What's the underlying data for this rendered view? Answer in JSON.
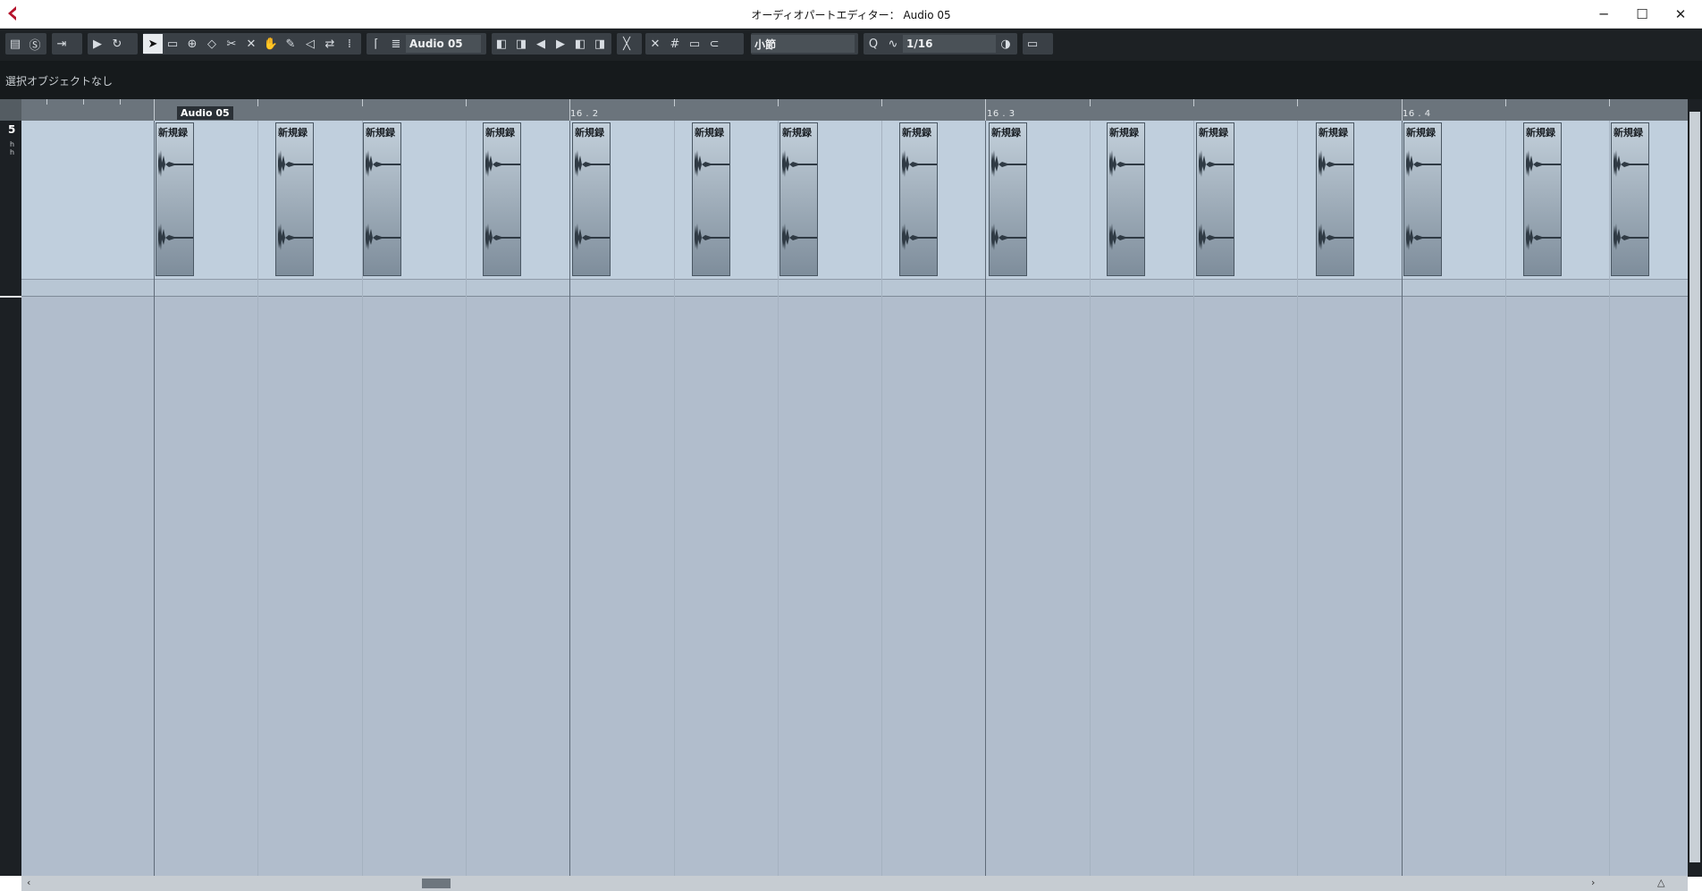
{
  "window": {
    "title": "オーディオパートエディター： Audio 05",
    "minimize": "─",
    "maximize": "☐",
    "close": "✕",
    "brand_color": "#b5122b"
  },
  "toolbar": {
    "part_name": "Audio 05",
    "grid_type": "小節",
    "quantize_label": "Q",
    "quantize_value": "1/16",
    "icons": [
      "inspector-icon",
      "solo-icon",
      "autoscroll-icon",
      "play-icon",
      "loop-icon",
      "object-select-icon",
      "range-icon",
      "zoom-icon",
      "draw-event-icon",
      "split-icon",
      "glue-icon",
      "erase-icon",
      "grab-icon",
      "pencil-icon",
      "speaker-icon",
      "timewarp-icon",
      "hitpoint-icon",
      "show-part-borders-icon",
      "nudge-icon",
      "snap-icon",
      "grid-icon",
      "quantize-icon",
      "color-icon"
    ]
  },
  "info": {
    "text": "選択オブジェクトなし"
  },
  "ruler": {
    "part_label": "Audio 05",
    "labels": [
      "16 . 2",
      "16 . 3",
      "16 . 4"
    ]
  },
  "lane": {
    "number": "5",
    "sub": "h\nh"
  },
  "events": [
    {
      "name": "新規録"
    },
    {
      "name": "新規録"
    },
    {
      "name": "新規録"
    },
    {
      "name": "新規録"
    },
    {
      "name": "新規録"
    },
    {
      "name": "新規録"
    },
    {
      "name": "新規録"
    },
    {
      "name": "新規録"
    },
    {
      "name": "新規録"
    },
    {
      "name": "新規録"
    },
    {
      "name": "新規録"
    },
    {
      "name": "新規録"
    },
    {
      "name": "新規録"
    },
    {
      "name": "新規録"
    },
    {
      "name": "新規録"
    }
  ]
}
